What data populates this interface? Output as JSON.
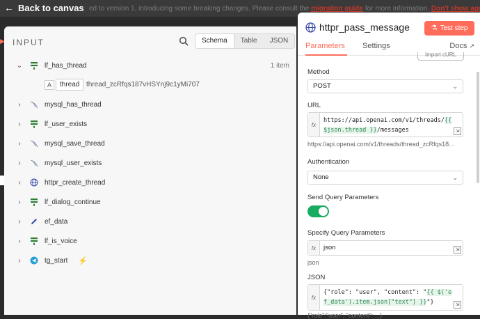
{
  "topbar": {
    "back_label": "Back to canvas",
    "banner_text": "ed to version 1, introducing some breaking changes. Please consult the",
    "banner_link": "migration guide",
    "banner_rest": "for more information.",
    "banner_dismiss": "Don't show again"
  },
  "input": {
    "title": "INPUT",
    "tabs": [
      "Schema",
      "Table",
      "JSON"
    ],
    "active_tab": "Schema",
    "nodes": [
      {
        "name": "lf_has_thread",
        "icon": "filter-icon",
        "count": "1 item",
        "expanded": true
      },
      {
        "name": "mysql_has_thread",
        "icon": "mysql-icon"
      },
      {
        "name": "lf_user_exists",
        "icon": "filter-icon"
      },
      {
        "name": "mysql_save_thread",
        "icon": "mysql-icon"
      },
      {
        "name": "mysql_user_exists",
        "icon": "mysql-icon"
      },
      {
        "name": "httpr_create_thread",
        "icon": "globe-icon"
      },
      {
        "name": "lf_dialog_continue",
        "icon": "filter-icon"
      },
      {
        "name": "ef_data",
        "icon": "pen-icon"
      },
      {
        "name": "lf_is_voice",
        "icon": "filter-icon"
      },
      {
        "name": "tg_start",
        "icon": "telegram-icon",
        "trigger": true
      }
    ],
    "field": {
      "type_badge": "A",
      "key": "thread",
      "value": "thread_zcRfqs187vHSYnj9c1yMi707"
    }
  },
  "node": {
    "title": "httpr_pass_message",
    "test_button": "Test step",
    "tabs": {
      "parameters": "Parameters",
      "settings": "Settings",
      "docs": "Docs"
    },
    "import_label": "Import cURL",
    "method_label": "Method",
    "method_value": "POST",
    "url_label": "URL",
    "url_prefix": "https://api.openai.com/v1/threads/",
    "url_expr": "{{ $json.thread }}",
    "url_suffix": "/messages",
    "url_preview": "https://api.openai.com/v1/threads/thread_zcRfqs18...",
    "auth_label": "Authentication",
    "auth_value": "None",
    "send_query_label": "Send Query Parameters",
    "specify_label": "Specify Query Parameters",
    "specify_value": "json",
    "specify_preview": "json",
    "json_label": "JSON",
    "json_prefix": "{\"role\": \"user\", \"content\": \"",
    "json_expr": "{{ $('ef_data').item.json[\"text\"] }}",
    "json_suffix": "\"}",
    "json_preview": "{\"role\":\"user\", \"content\": ...}"
  },
  "colors": {
    "accent": "#ff6d5a",
    "toggle_on": "#19ab60",
    "filter_green": "#2e7d32",
    "trigger_red": "#e5533d"
  }
}
